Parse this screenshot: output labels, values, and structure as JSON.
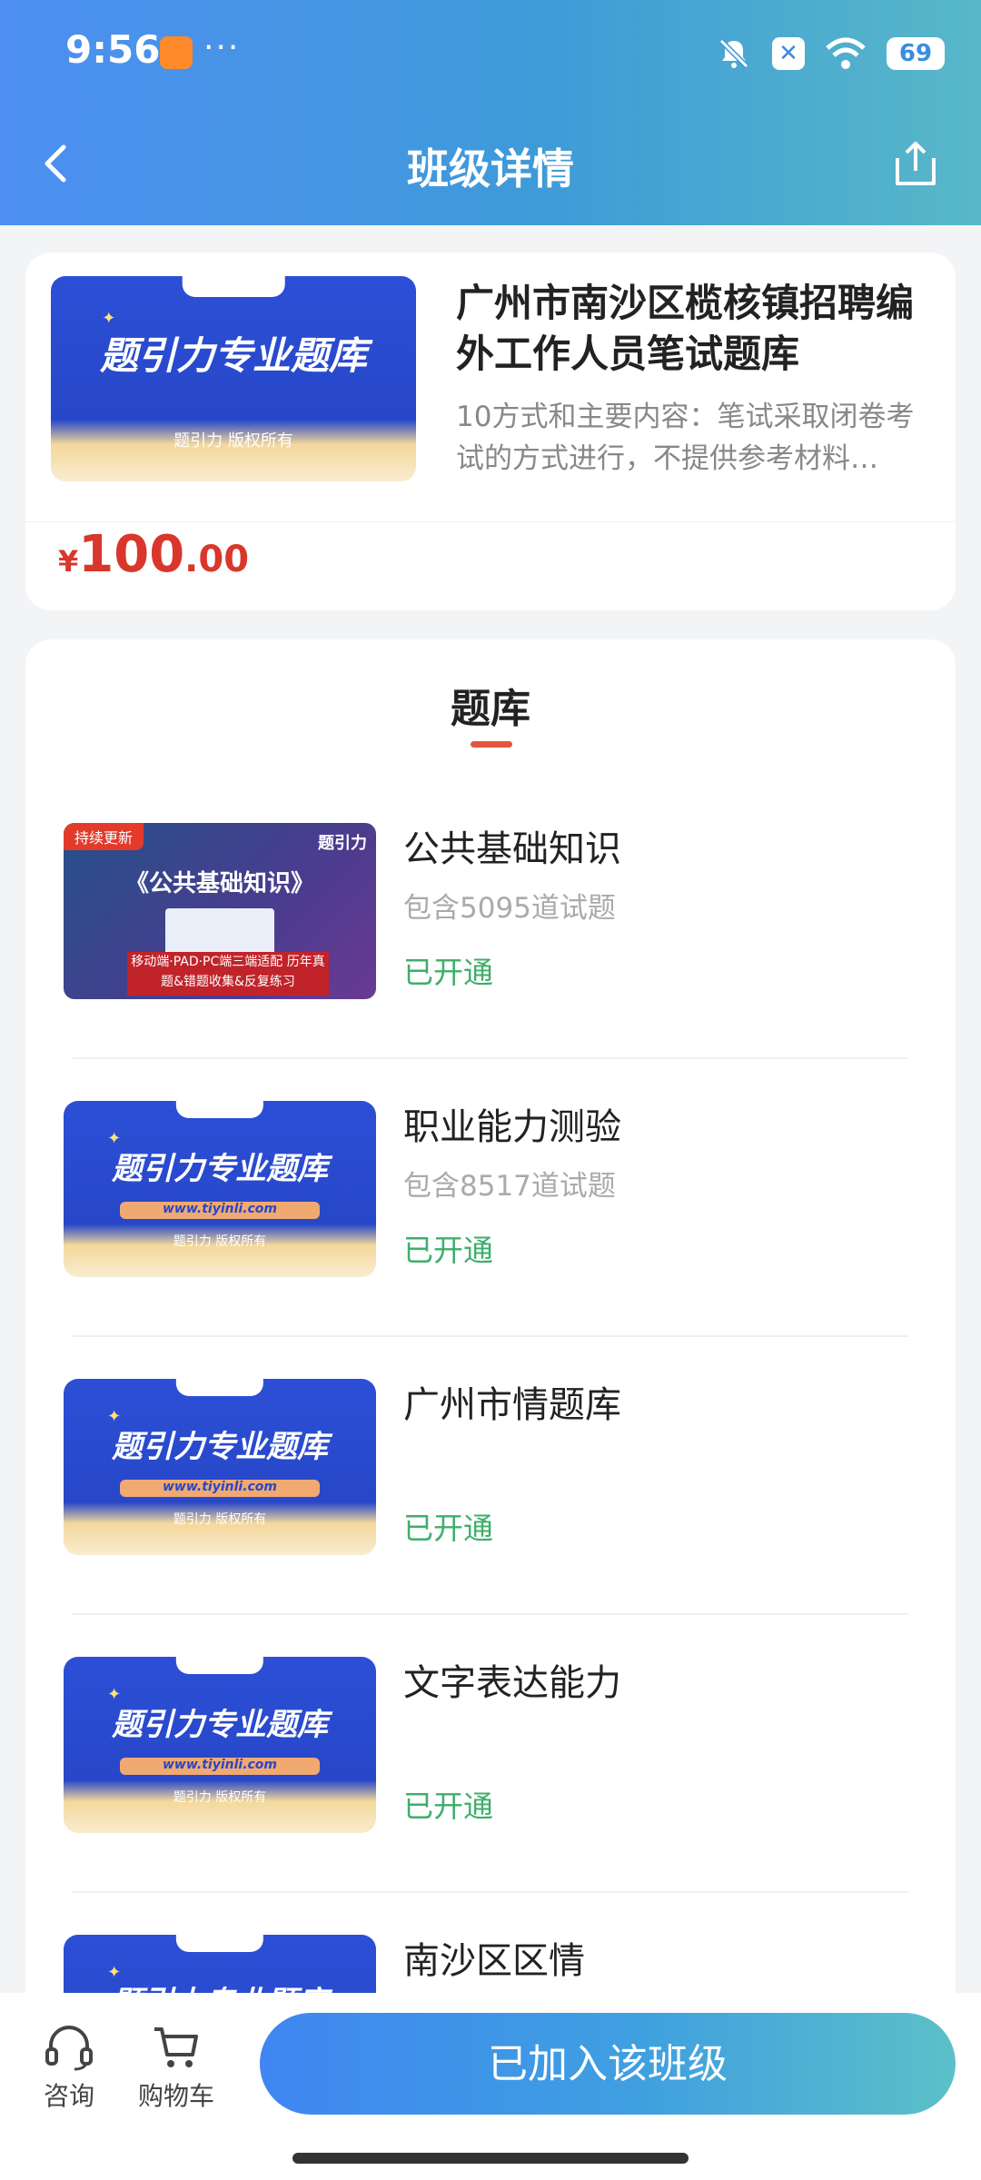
{
  "status_bar": {
    "time": "9:56",
    "dots": "···",
    "battery": "69"
  },
  "nav": {
    "title": "班级详情"
  },
  "course": {
    "title": "广州市南沙区榄核镇招聘编外工作人员笔试题库",
    "description": "10方式和主要内容：笔试采取闭卷考试的方式进行，不提供参考材料…",
    "price_symbol": "¥",
    "price_integer": "100",
    "price_decimal": ".00",
    "cover": {
      "title": "题引力专业题库",
      "sub": "题引力 版权所有"
    }
  },
  "bank": {
    "section_title": "题库",
    "items": [
      {
        "name": "公共基础知识",
        "count": "包含5095道试题",
        "status": "已开通",
        "cover": {
          "tag": "持续更新",
          "title": "《公共基础知识》",
          "brand": "题引力",
          "box": "移动端·PAD·PC端三端适配 历年真题&错题收集&反复练习"
        }
      },
      {
        "name": "职业能力测验",
        "count": "包含8517道试题",
        "status": "已开通"
      },
      {
        "name": "广州市情题库",
        "count": "",
        "status": "已开通"
      },
      {
        "name": "文字表达能力",
        "count": "",
        "status": "已开通"
      },
      {
        "name": "南沙区区情",
        "count": "",
        "status": ""
      }
    ],
    "cover": {
      "title": "题引力专业题库",
      "url": "www.tiyinli.com",
      "sub": "题引力 版权所有"
    }
  },
  "bottom": {
    "consult_label": "咨询",
    "cart_label": "购物车",
    "join_label": "已加入该班级"
  },
  "colors": {
    "accent": "#3f86f2",
    "price": "#d9372c",
    "opened": "#3fae6b",
    "underline": "#e2553f"
  }
}
